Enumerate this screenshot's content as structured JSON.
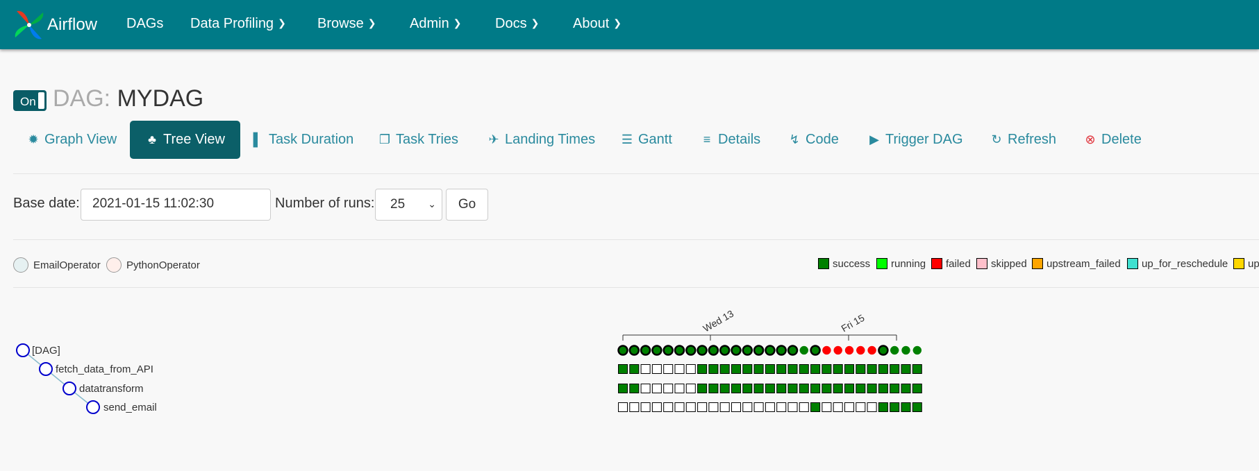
{
  "navbar": {
    "brand": "Airflow",
    "items": [
      {
        "label": "DAGs",
        "caret": false
      },
      {
        "label": "Data Profiling",
        "caret": true
      },
      {
        "label": "Browse",
        "caret": true
      },
      {
        "label": "Admin",
        "caret": true
      },
      {
        "label": "Docs",
        "caret": true
      },
      {
        "label": "About",
        "caret": true
      }
    ],
    "color": "#007a87"
  },
  "dag": {
    "toggle_label": "On",
    "prefix": "DAG:",
    "name": "MYDAG"
  },
  "tabs": [
    {
      "label": "Graph View",
      "icon": "asterisk-icon"
    },
    {
      "label": "Tree View",
      "icon": "tree-icon",
      "active": true
    },
    {
      "label": "Task Duration",
      "icon": "bar-chart-icon"
    },
    {
      "label": "Task Tries",
      "icon": "duplicate-icon"
    },
    {
      "label": "Landing Times",
      "icon": "plane-icon"
    },
    {
      "label": "Gantt",
      "icon": "gantt-icon"
    },
    {
      "label": "Details",
      "icon": "list-icon"
    },
    {
      "label": "Code",
      "icon": "flash-icon"
    },
    {
      "label": "Trigger DAG",
      "icon": "play-circle-icon"
    },
    {
      "label": "Refresh",
      "icon": "refresh-icon"
    },
    {
      "label": "Delete",
      "icon": "remove-circle-icon"
    }
  ],
  "form": {
    "base_date_label": "Base date:",
    "base_date_value": "2021-01-15 11:02:30",
    "num_runs_label": "Number of runs:",
    "num_runs_value": "25",
    "go_label": "Go"
  },
  "operator_legend": [
    {
      "label": "EmailOperator",
      "color": "#e6f1f2"
    },
    {
      "label": "PythonOperator",
      "color": "#ffefeb"
    }
  ],
  "state_legend": [
    {
      "label": "success",
      "color": "#008000"
    },
    {
      "label": "running",
      "color": "#00ff00"
    },
    {
      "label": "failed",
      "color": "#ff0000"
    },
    {
      "label": "skipped",
      "color": "#ffc0cb"
    },
    {
      "label": "upstream_failed",
      "color": "#ffa500"
    },
    {
      "label": "up_for_reschedule",
      "color": "#40e0d0"
    },
    {
      "label": "up",
      "color": "#ffd700"
    }
  ],
  "tree": {
    "nodes": [
      "[DAG]",
      "fetch_data_from_API",
      "datatransform",
      "send_email"
    ],
    "axis_labels": [
      "Wed 13",
      "Fri 15"
    ],
    "dag_runs": [
      "s",
      "s",
      "s",
      "s",
      "s",
      "s",
      "s",
      "s",
      "s",
      "s",
      "s",
      "s",
      "s",
      "s",
      "s",
      "s",
      "s",
      "s",
      "f",
      "f",
      "f",
      "f",
      "f",
      "s",
      "s",
      "s",
      "s"
    ],
    "dag_runs_bold": [
      1,
      1,
      1,
      1,
      1,
      1,
      1,
      1,
      1,
      1,
      1,
      1,
      1,
      1,
      1,
      1,
      0,
      1,
      0,
      0,
      0,
      0,
      0,
      1,
      0,
      0,
      0
    ],
    "task_rows": [
      [
        "s",
        "s",
        "n",
        "n",
        "n",
        "n",
        "n",
        "s",
        "s",
        "s",
        "s",
        "s",
        "s",
        "s",
        "s",
        "s",
        "s",
        "s",
        "s",
        "s",
        "s",
        "s",
        "s",
        "s",
        "s",
        "s",
        "s"
      ],
      [
        "s",
        "s",
        "n",
        "n",
        "n",
        "n",
        "n",
        "s",
        "s",
        "s",
        "s",
        "s",
        "s",
        "s",
        "s",
        "s",
        "s",
        "s",
        "s",
        "s",
        "s",
        "s",
        "s",
        "s",
        "s",
        "s",
        "s"
      ],
      [
        "n",
        "n",
        "n",
        "n",
        "n",
        "n",
        "n",
        "n",
        "n",
        "n",
        "n",
        "n",
        "n",
        "n",
        "n",
        "n",
        "n",
        "s",
        "n",
        "n",
        "n",
        "n",
        "n",
        "s",
        "s",
        "s",
        "s"
      ]
    ],
    "colors": {
      "s": "#008000",
      "f": "#ff0000",
      "n": "#ffffff"
    }
  }
}
